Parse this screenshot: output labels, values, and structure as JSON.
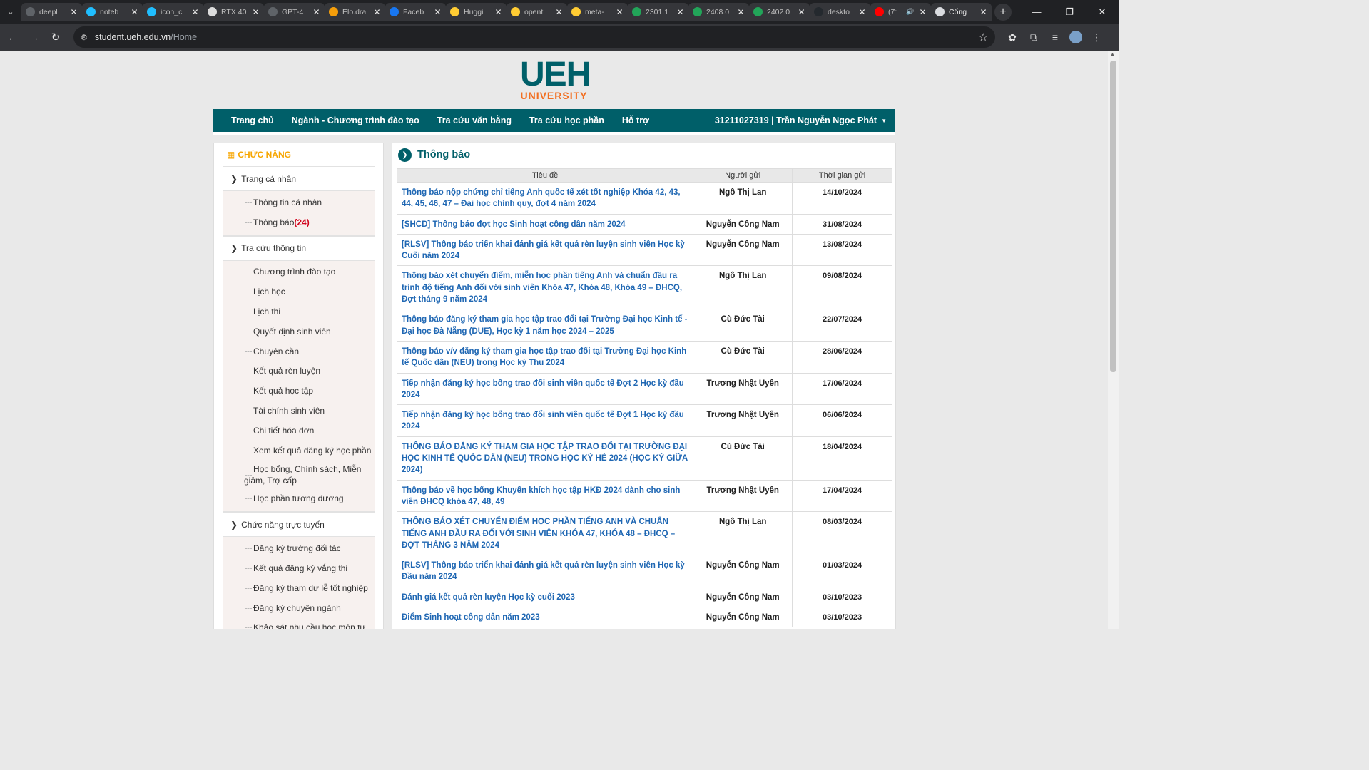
{
  "browser": {
    "tabs": [
      {
        "title": "deepl",
        "icon": "globe-icon"
      },
      {
        "title": "noteb",
        "icon": "kaggle-icon"
      },
      {
        "title": "icon_c",
        "icon": "kaggle-icon"
      },
      {
        "title": "RTX 40",
        "icon": "openai-icon"
      },
      {
        "title": "GPT-4",
        "icon": "globe-icon"
      },
      {
        "title": "Elo.dra",
        "icon": "elo-icon"
      },
      {
        "title": "Faceb",
        "icon": "facebook-icon"
      },
      {
        "title": "Huggi",
        "icon": "huggingface-icon"
      },
      {
        "title": "opent",
        "icon": "huggingface-icon"
      },
      {
        "title": "meta-",
        "icon": "huggingface-icon"
      },
      {
        "title": "2301.1",
        "icon": "paper-icon"
      },
      {
        "title": "2408.0",
        "icon": "paper-icon"
      },
      {
        "title": "2402.0",
        "icon": "paper-icon"
      },
      {
        "title": "deskto",
        "icon": "github-icon"
      },
      {
        "title": "(7:",
        "icon": "youtube-icon",
        "audio": true
      },
      {
        "title": "Cổng",
        "icon": "page-icon",
        "active": true
      }
    ],
    "url_host": "student.ueh.edu.vn",
    "url_path": "/Home"
  },
  "logo": {
    "main": "UEH",
    "sub": "UNIVERSITY"
  },
  "nav": {
    "items": [
      "Trang chủ",
      "Ngành - Chương trình đào tạo",
      "Tra cứu văn bằng",
      "Tra cứu học phần",
      "Hỗ trợ"
    ],
    "user": "31211027319 | Trần Nguyễn Ngọc Phát"
  },
  "sidebar": {
    "heading": "CHỨC NĂNG",
    "groups": [
      {
        "title": "Trang cá nhân",
        "items": [
          {
            "label": "Thông tin cá nhân"
          },
          {
            "label": "Thông báo",
            "count": "(24)"
          }
        ]
      },
      {
        "title": "Tra cứu thông tin",
        "items": [
          {
            "label": "Chương trình đào tạo"
          },
          {
            "label": "Lịch học"
          },
          {
            "label": "Lịch thi"
          },
          {
            "label": "Quyết định sinh viên"
          },
          {
            "label": "Chuyên cần"
          },
          {
            "label": "Kết quả rèn luyện"
          },
          {
            "label": "Kết quả học tập"
          },
          {
            "label": "Tài chính sinh viên"
          },
          {
            "label": "Chi tiết hóa đơn"
          },
          {
            "label": "Xem kết quả đăng ký học phần"
          },
          {
            "label": "Học bổng, Chính sách, Miễn giảm, Trợ cấp"
          },
          {
            "label": "Học phần tương đương"
          }
        ]
      },
      {
        "title": "Chức năng trực tuyến",
        "items": [
          {
            "label": "Đăng ký trường đối tác"
          },
          {
            "label": "Kết quả đăng ký vắng thi"
          },
          {
            "label": "Đăng ký tham dự lễ tốt nghiệp"
          },
          {
            "label": "Đăng ký chuyên ngành"
          },
          {
            "label": "Khảo sát nhu cầu học môn tự"
          }
        ]
      }
    ]
  },
  "main": {
    "title": "Thông báo",
    "columns": [
      "Tiêu đề",
      "Người gửi",
      "Thời gian gửi"
    ],
    "rows": [
      {
        "title": "Thông báo nộp chứng chỉ tiếng Anh quốc tế xét tốt nghiệp Khóa 42, 43, 44, 45, 46, 47 – Đại học chính quy, đợt 4 năm 2024",
        "sender": "Ngô Thị Lan",
        "date": "14/10/2024"
      },
      {
        "title": "[SHCD] Thông báo đợt học Sinh hoạt công dân năm 2024",
        "sender": "Nguyễn Công Nam",
        "date": "31/08/2024"
      },
      {
        "title": "[RLSV] Thông báo triển khai đánh giá kết quả rèn luyện sinh viên Học kỳ Cuối năm 2024",
        "sender": "Nguyễn Công Nam",
        "date": "13/08/2024"
      },
      {
        "title": "Thông báo xét chuyển điểm, miễn học phần tiếng Anh và chuẩn đầu ra trình độ tiếng Anh đối với sinh viên Khóa 47, Khóa 48, Khóa 49 – ĐHCQ, Đợt tháng 9 năm 2024",
        "sender": "Ngô Thị Lan",
        "date": "09/08/2024"
      },
      {
        "title": "Thông báo đăng ký tham gia học tập trao đổi tại Trường Đại học Kinh tế - Đại học Đà Nẵng (DUE), Học kỳ 1 năm học 2024 – 2025",
        "sender": "Cù Đức Tài",
        "date": "22/07/2024"
      },
      {
        "title": "Thông báo v/v đăng ký tham gia học tập trao đổi tại Trường Đại học Kinh tế Quốc dân (NEU) trong Học kỳ Thu 2024",
        "sender": "Cù Đức Tài",
        "date": "28/06/2024"
      },
      {
        "title": "Tiếp nhận đăng ký học bổng trao đổi sinh viên quốc tế Đợt 2 Học kỳ đầu 2024",
        "sender": "Trương Nhật Uyên",
        "date": "17/06/2024"
      },
      {
        "title": "Tiếp nhận đăng ký học bổng trao đổi sinh viên quốc tế Đợt 1 Học kỳ đầu 2024",
        "sender": "Trương Nhật Uyên",
        "date": "06/06/2024"
      },
      {
        "title": "THÔNG BÁO ĐĂNG KÝ THAM GIA HỌC TẬP TRAO ĐỔI TẠI TRƯỜNG ĐẠI HỌC KINH TẾ QUỐC DÂN (NEU) TRONG HỌC KỲ HÈ 2024 (HỌC KỲ GIỮA 2024)",
        "sender": "Cù Đức Tài",
        "date": "18/04/2024"
      },
      {
        "title": "Thông báo về học bổng Khuyến khích học tập HKĐ 2024 dành cho sinh viên ĐHCQ khóa 47, 48, 49",
        "sender": "Trương Nhật Uyên",
        "date": "17/04/2024"
      },
      {
        "title": "THÔNG BÁO XÉT CHUYỂN ĐIỂM HỌC PHẦN TIẾNG ANH VÀ CHUẨN TIẾNG ANH ĐẦU RA ĐỐI VỚI SINH VIÊN KHÓA 47, KHÓA 48 – ĐHCQ – ĐỢT THÁNG 3 NĂM 2024",
        "sender": "Ngô Thị Lan",
        "date": "08/03/2024"
      },
      {
        "title": "[RLSV] Thông báo triển khai đánh giá kết quả rèn luyện sinh viên Học kỳ Đầu năm 2024",
        "sender": "Nguyễn Công Nam",
        "date": "01/03/2024"
      },
      {
        "title": "Đánh giá kết quả rèn luyện Học kỳ cuối 2023",
        "sender": "Nguyễn Công Nam",
        "date": "03/10/2023"
      },
      {
        "title": "Điểm Sinh hoạt công dân năm 2023",
        "sender": "Nguyễn Công Nam",
        "date": "03/10/2023"
      }
    ]
  }
}
